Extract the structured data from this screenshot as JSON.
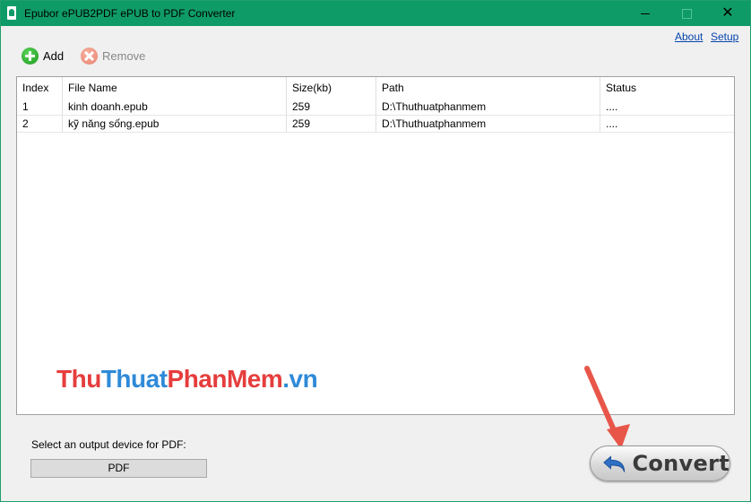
{
  "window": {
    "title": "Epubor ePUB2PDF ePUB to PDF Converter",
    "minimize_label": "",
    "close_label": "✕"
  },
  "links": {
    "about": "About",
    "setup": "Setup"
  },
  "toolbar": {
    "add_label": "Add",
    "remove_label": "Remove"
  },
  "list": {
    "columns": [
      "Index",
      "File Name",
      "Size(kb)",
      "Path",
      "Status"
    ],
    "rows": [
      [
        "1",
        "kinh doanh.epub",
        "259",
        "D:\\Thuthuatphanmem",
        "...."
      ],
      [
        "2",
        "kỹ năng sống.epub",
        "259",
        "D:\\Thuthuatphanmem",
        "...."
      ]
    ]
  },
  "watermark": {
    "part1": "Thu",
    "part2": "Thuat",
    "part3": "PhanMem",
    "part4": ".vn"
  },
  "output": {
    "label": "Select an output device for PDF:",
    "selected": "PDF"
  },
  "convert": {
    "label": "Convert"
  },
  "colors": {
    "titlebar": "#0f9b68",
    "link": "#0645ad",
    "arrow": "#e8564a"
  }
}
